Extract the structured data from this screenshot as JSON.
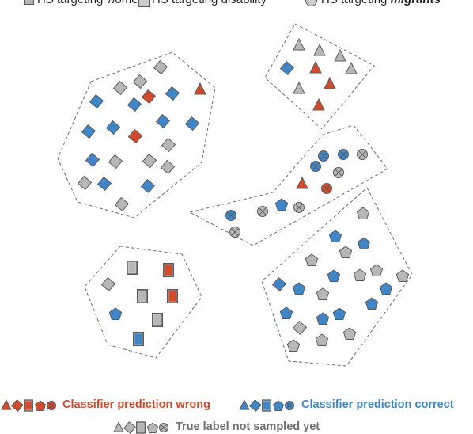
{
  "top_legend": {
    "items": [
      {
        "prefix": "HS targeting",
        "target": "women"
      },
      {
        "prefix": "HS targeting",
        "target": "disability"
      },
      {
        "prefix": "HS targeting",
        "target": "migrants"
      }
    ]
  },
  "bottom_legend": {
    "wrong": "Classifier prediction wrong",
    "correct": "Classifier prediction correct",
    "unsampled": "True label not sampled yet"
  },
  "colors": {
    "wrong": "#d24a2c",
    "correct": "#3f86c8",
    "unsampled": "#b7b7b7",
    "outline": "#5a5a5a",
    "cluster_border": "#777777"
  },
  "marker_shapes": [
    "triangle",
    "diamond",
    "rectangle",
    "pentagon",
    "circle-x"
  ]
}
